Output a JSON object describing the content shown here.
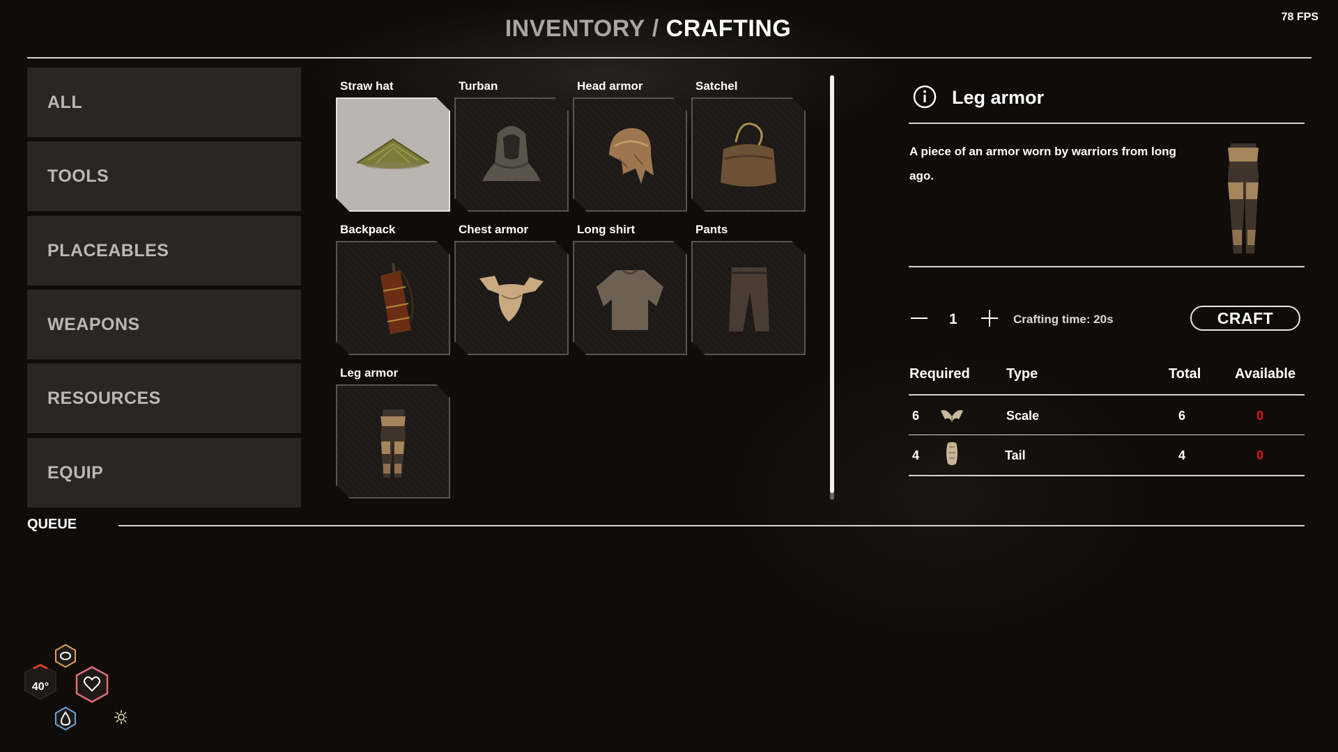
{
  "header": {
    "fps": "78 FPS",
    "breadcrumb_inventory": "INVENTORY",
    "breadcrumb_separator": "/",
    "breadcrumb_crafting": "CRAFTING"
  },
  "categories": [
    {
      "label": "ALL"
    },
    {
      "label": "TOOLS"
    },
    {
      "label": "PLACEABLES"
    },
    {
      "label": "WEAPONS"
    },
    {
      "label": "RESOURCES"
    },
    {
      "label": "EQUIP"
    }
  ],
  "items": [
    {
      "label": "Straw hat",
      "icon": "straw-hat-icon",
      "selected": true
    },
    {
      "label": "Turban",
      "icon": "turban-icon",
      "selected": false
    },
    {
      "label": "Head armor",
      "icon": "head-armor-icon",
      "selected": false
    },
    {
      "label": "Satchel",
      "icon": "satchel-icon",
      "selected": false
    },
    {
      "label": "Backpack",
      "icon": "backpack-icon",
      "selected": false
    },
    {
      "label": "Chest armor",
      "icon": "chest-armor-icon",
      "selected": false
    },
    {
      "label": "Long shirt",
      "icon": "long-shirt-icon",
      "selected": false
    },
    {
      "label": "Pants",
      "icon": "pants-icon",
      "selected": false
    },
    {
      "label": "Leg armor",
      "icon": "leg-armor-icon",
      "selected": false
    }
  ],
  "detail": {
    "title": "Leg armor",
    "description": "A piece of an armor worn by warriors from long ago.",
    "quantity": "1",
    "crafting_time": "Crafting time: 20s",
    "craft_label": "CRAFT",
    "columns": {
      "required": "Required",
      "type": "Type",
      "total": "Total",
      "available": "Available"
    },
    "requirements": [
      {
        "required": "6",
        "icon": "scale-icon",
        "type": "Scale",
        "total": "6",
        "available": "0"
      },
      {
        "required": "4",
        "icon": "tail-icon",
        "type": "Tail",
        "total": "4",
        "available": "0"
      }
    ]
  },
  "queue": {
    "label": "QUEUE"
  },
  "hud": {
    "temperature": "40°"
  },
  "colors": {
    "unavailable": "#e01818",
    "health": "#e0707a",
    "water": "#6fa3d8",
    "food": "#e2a24a"
  }
}
